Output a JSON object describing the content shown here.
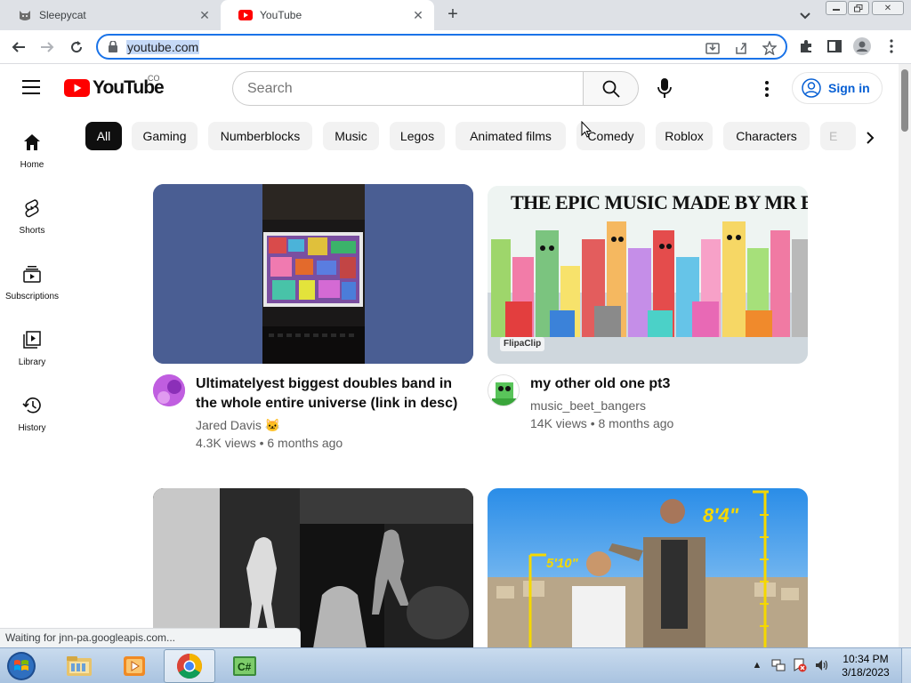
{
  "browser": {
    "tabs": [
      {
        "title": "Sleepycat",
        "favicon": "cat-icon"
      },
      {
        "title": "YouTube",
        "favicon": "youtube-icon",
        "active": true
      }
    ],
    "url": "youtube.com",
    "status": "Waiting for jnn-pa.googleapis.com..."
  },
  "youtube": {
    "logo_text": "YouTube",
    "country_code": "CO",
    "search_placeholder": "Search",
    "signin_label": "Sign in",
    "chips": [
      "All",
      "Gaming",
      "Numberblocks",
      "Music",
      "Legos",
      "Animated films",
      "Comedy",
      "Roblox",
      "Characters",
      "E"
    ],
    "guide": [
      {
        "label": "Home",
        "icon": "home-icon"
      },
      {
        "label": "Shorts",
        "icon": "shorts-icon"
      },
      {
        "label": "Subscriptions",
        "icon": "subscriptions-icon"
      },
      {
        "label": "Library",
        "icon": "library-icon"
      },
      {
        "label": "History",
        "icon": "history-icon"
      }
    ],
    "videos": [
      {
        "title_line1": "Ultimatelyest biggest doubles band in",
        "title_line2": "the whole entire universe (link in desc)",
        "channel": "Jared Davis 🐱",
        "meta": "4.3K views • 6 months ago"
      },
      {
        "title_line1": "my other old one pt3",
        "title_line2": "",
        "channel": "music_beet_bangers",
        "meta": "14K views • 8 months ago",
        "thumb_text": "THE EPIC MUSIC MADE BY MR BLOCK",
        "thumb_watermark": "FlipaClip"
      },
      {
        "title_line1": "",
        "channel": "",
        "meta": ""
      },
      {
        "title_line1": "",
        "channel": "",
        "meta": "",
        "thumb_text_a": "8'4\"",
        "thumb_text_b": "5'10\""
      }
    ]
  },
  "taskbar": {
    "apps": [
      "windows-explorer",
      "media-player",
      "chrome",
      "csharp-app"
    ],
    "time": "10:34 PM",
    "date": "3/18/2023"
  },
  "colors": {
    "youtube_red": "#ff0000",
    "link_blue": "#065fd4",
    "omnibox_focus": "#1a73e8"
  }
}
